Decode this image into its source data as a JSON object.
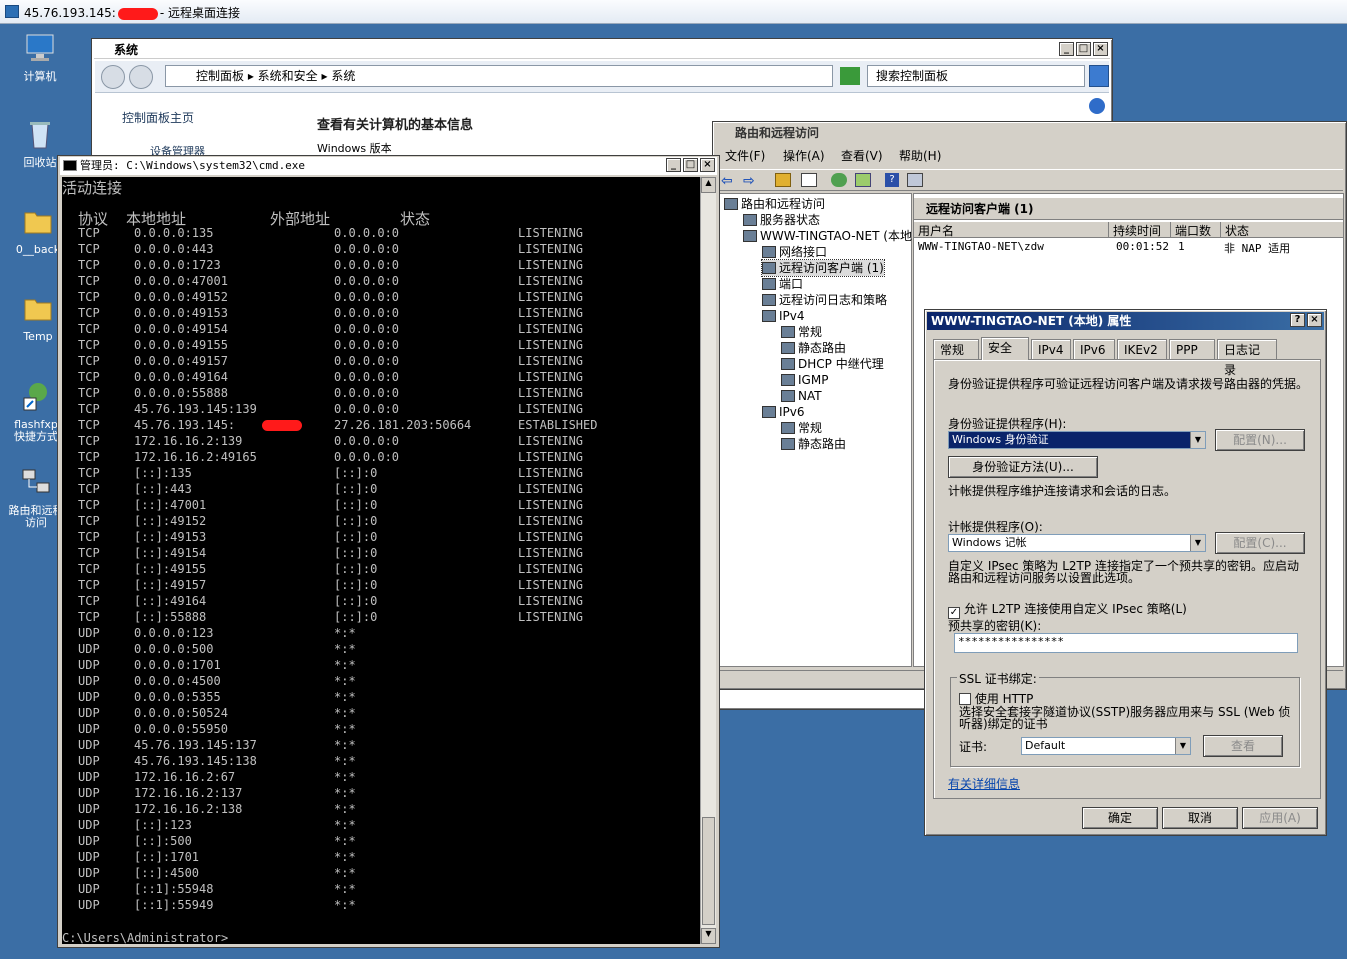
{
  "rdp": {
    "title_prefix": "45.76.193.145:",
    "title_suffix": "- 远程桌面连接"
  },
  "desktop": {
    "icons": [
      {
        "label": "计算机",
        "icon": "computer-icon"
      },
      {
        "label": "回收站",
        "icon": "recycle-bin-icon"
      },
      {
        "label": "0__back",
        "icon": "folder-icon"
      },
      {
        "label": "Temp",
        "icon": "folder-icon"
      },
      {
        "label": "flashfxp 快捷方式",
        "icon": "shortcut-icon"
      },
      {
        "label": "路由和远程访问",
        "icon": "routing-icon"
      }
    ]
  },
  "system_window": {
    "title": "系统",
    "breadcrumb": [
      "控制面板",
      "系统和安全",
      "系统"
    ],
    "search_placeholder": "搜索控制面板",
    "sidebar_home": "控制面板主页",
    "sidebar_item": "设备管理器",
    "heading": "查看有关计算机的基本信息",
    "section": "Windows 版本"
  },
  "cmd": {
    "title": "管理员: C:\\Windows\\system32\\cmd.exe",
    "heading": "活动连接",
    "headers": [
      "协议",
      "本地地址",
      "外部地址",
      "状态"
    ],
    "rows": [
      [
        "TCP",
        "0.0.0.0:135",
        "0.0.0.0:0",
        "LISTENING"
      ],
      [
        "TCP",
        "0.0.0.0:443",
        "0.0.0.0:0",
        "LISTENING"
      ],
      [
        "TCP",
        "0.0.0.0:1723",
        "0.0.0.0:0",
        "LISTENING"
      ],
      [
        "TCP",
        "0.0.0.0:47001",
        "0.0.0.0:0",
        "LISTENING"
      ],
      [
        "TCP",
        "0.0.0.0:49152",
        "0.0.0.0:0",
        "LISTENING"
      ],
      [
        "TCP",
        "0.0.0.0:49153",
        "0.0.0.0:0",
        "LISTENING"
      ],
      [
        "TCP",
        "0.0.0.0:49154",
        "0.0.0.0:0",
        "LISTENING"
      ],
      [
        "TCP",
        "0.0.0.0:49155",
        "0.0.0.0:0",
        "LISTENING"
      ],
      [
        "TCP",
        "0.0.0.0:49157",
        "0.0.0.0:0",
        "LISTENING"
      ],
      [
        "TCP",
        "0.0.0.0:49164",
        "0.0.0.0:0",
        "LISTENING"
      ],
      [
        "TCP",
        "0.0.0.0:55888",
        "0.0.0.0:0",
        "LISTENING"
      ],
      [
        "TCP",
        "45.76.193.145:139",
        "0.0.0.0:0",
        "LISTENING"
      ],
      [
        "TCP",
        "45.76.193.145:",
        "27.26.181.203:50664",
        "ESTABLISHED"
      ],
      [
        "TCP",
        "172.16.16.2:139",
        "0.0.0.0:0",
        "LISTENING"
      ],
      [
        "TCP",
        "172.16.16.2:49165",
        "0.0.0.0:0",
        "LISTENING"
      ],
      [
        "TCP",
        "[::]:135",
        "[::]:0",
        "LISTENING"
      ],
      [
        "TCP",
        "[::]:443",
        "[::]:0",
        "LISTENING"
      ],
      [
        "TCP",
        "[::]:47001",
        "[::]:0",
        "LISTENING"
      ],
      [
        "TCP",
        "[::]:49152",
        "[::]:0",
        "LISTENING"
      ],
      [
        "TCP",
        "[::]:49153",
        "[::]:0",
        "LISTENING"
      ],
      [
        "TCP",
        "[::]:49154",
        "[::]:0",
        "LISTENING"
      ],
      [
        "TCP",
        "[::]:49155",
        "[::]:0",
        "LISTENING"
      ],
      [
        "TCP",
        "[::]:49157",
        "[::]:0",
        "LISTENING"
      ],
      [
        "TCP",
        "[::]:49164",
        "[::]:0",
        "LISTENING"
      ],
      [
        "TCP",
        "[::]:55888",
        "[::]:0",
        "LISTENING"
      ],
      [
        "UDP",
        "0.0.0.0:123",
        "*:*",
        ""
      ],
      [
        "UDP",
        "0.0.0.0:500",
        "*:*",
        ""
      ],
      [
        "UDP",
        "0.0.0.0:1701",
        "*:*",
        ""
      ],
      [
        "UDP",
        "0.0.0.0:4500",
        "*:*",
        ""
      ],
      [
        "UDP",
        "0.0.0.0:5355",
        "*:*",
        ""
      ],
      [
        "UDP",
        "0.0.0.0:50524",
        "*:*",
        ""
      ],
      [
        "UDP",
        "0.0.0.0:55950",
        "*:*",
        ""
      ],
      [
        "UDP",
        "45.76.193.145:137",
        "*:*",
        ""
      ],
      [
        "UDP",
        "45.76.193.145:138",
        "*:*",
        ""
      ],
      [
        "UDP",
        "172.16.16.2:67",
        "*:*",
        ""
      ],
      [
        "UDP",
        "172.16.16.2:137",
        "*:*",
        ""
      ],
      [
        "UDP",
        "172.16.16.2:138",
        "*:*",
        ""
      ],
      [
        "UDP",
        "[::]:123",
        "*:*",
        ""
      ],
      [
        "UDP",
        "[::]:500",
        "*:*",
        ""
      ],
      [
        "UDP",
        "[::]:1701",
        "*:*",
        ""
      ],
      [
        "UDP",
        "[::]:4500",
        "*:*",
        ""
      ],
      [
        "UDP",
        "[::1]:55948",
        "*:*",
        ""
      ],
      [
        "UDP",
        "[::1]:55949",
        "*:*",
        ""
      ]
    ],
    "prompt": "C:\\Users\\Administrator>"
  },
  "rras": {
    "title": "路由和远程访问",
    "menu": [
      "文件(F)",
      "操作(A)",
      "查看(V)",
      "帮助(H)"
    ],
    "tree": [
      {
        "label": "路由和远程访问",
        "depth": 0
      },
      {
        "label": "服务器状态",
        "depth": 1
      },
      {
        "label": "WWW-TINGTAO-NET (本地)",
        "depth": 1
      },
      {
        "label": "网络接口",
        "depth": 2
      },
      {
        "label": "远程访问客户端 (1)",
        "depth": 2
      },
      {
        "label": "端口",
        "depth": 2
      },
      {
        "label": "远程访问日志和策略",
        "depth": 2
      },
      {
        "label": "IPv4",
        "depth": 2
      },
      {
        "label": "常规",
        "depth": 3
      },
      {
        "label": "静态路由",
        "depth": 3
      },
      {
        "label": "DHCP 中继代理",
        "depth": 3
      },
      {
        "label": "IGMP",
        "depth": 3
      },
      {
        "label": "NAT",
        "depth": 3
      },
      {
        "label": "IPv6",
        "depth": 2
      },
      {
        "label": "常规",
        "depth": 3
      },
      {
        "label": "静态路由",
        "depth": 3
      }
    ],
    "pane_title": "远程访问客户端 (1)",
    "columns": [
      "用户名",
      "持续时间",
      "端口数",
      "状态"
    ],
    "row": [
      "WWW-TINGTAO-NET\\zdw",
      "00:01:52",
      "1",
      "非 NAP 适用"
    ]
  },
  "props": {
    "title": "WWW-TINGTAO-NET (本地) 属性",
    "tabs": [
      "常规",
      "安全",
      "IPv4",
      "IPv6",
      "IKEv2",
      "PPP",
      "日志记录"
    ],
    "desc": "身份验证提供程序可验证远程访问客户端及请求拨号路由器的凭据。",
    "auth_label": "身份验证提供程序(H):",
    "auth_value": "Windows 身份验证",
    "configure1": "配置(N)...",
    "auth_methods": "身份验证方法(U)...",
    "acct_desc": "计帐提供程序维护连接请求和会话的日志。",
    "acct_label": "计帐提供程序(O):",
    "acct_value": "Windows 记帐",
    "configure2": "配置(C)...",
    "ipsec_desc": "自定义 IPsec 策略为 L2TP 连接指定了一个预共享的密钥。应启动路由和远程访问服务以设置此选项。",
    "allow_l2tp": "允许 L2TP 连接使用自定义 IPsec 策略(L)",
    "psk_label": "预共享的密钥(K):",
    "psk_value": "****************",
    "ssl_group": "SSL 证书绑定:",
    "use_http": "使用 HTTP",
    "sstp_desc": "选择安全套接字隧道协议(SSTP)服务器应用来与 SSL (Web 侦听器)绑定的证书",
    "cert_label": "证书:",
    "cert_value": "Default",
    "view": "查看",
    "more_info": "有关详细信息",
    "ok": "确定",
    "cancel": "取消",
    "apply": "应用(A)"
  }
}
